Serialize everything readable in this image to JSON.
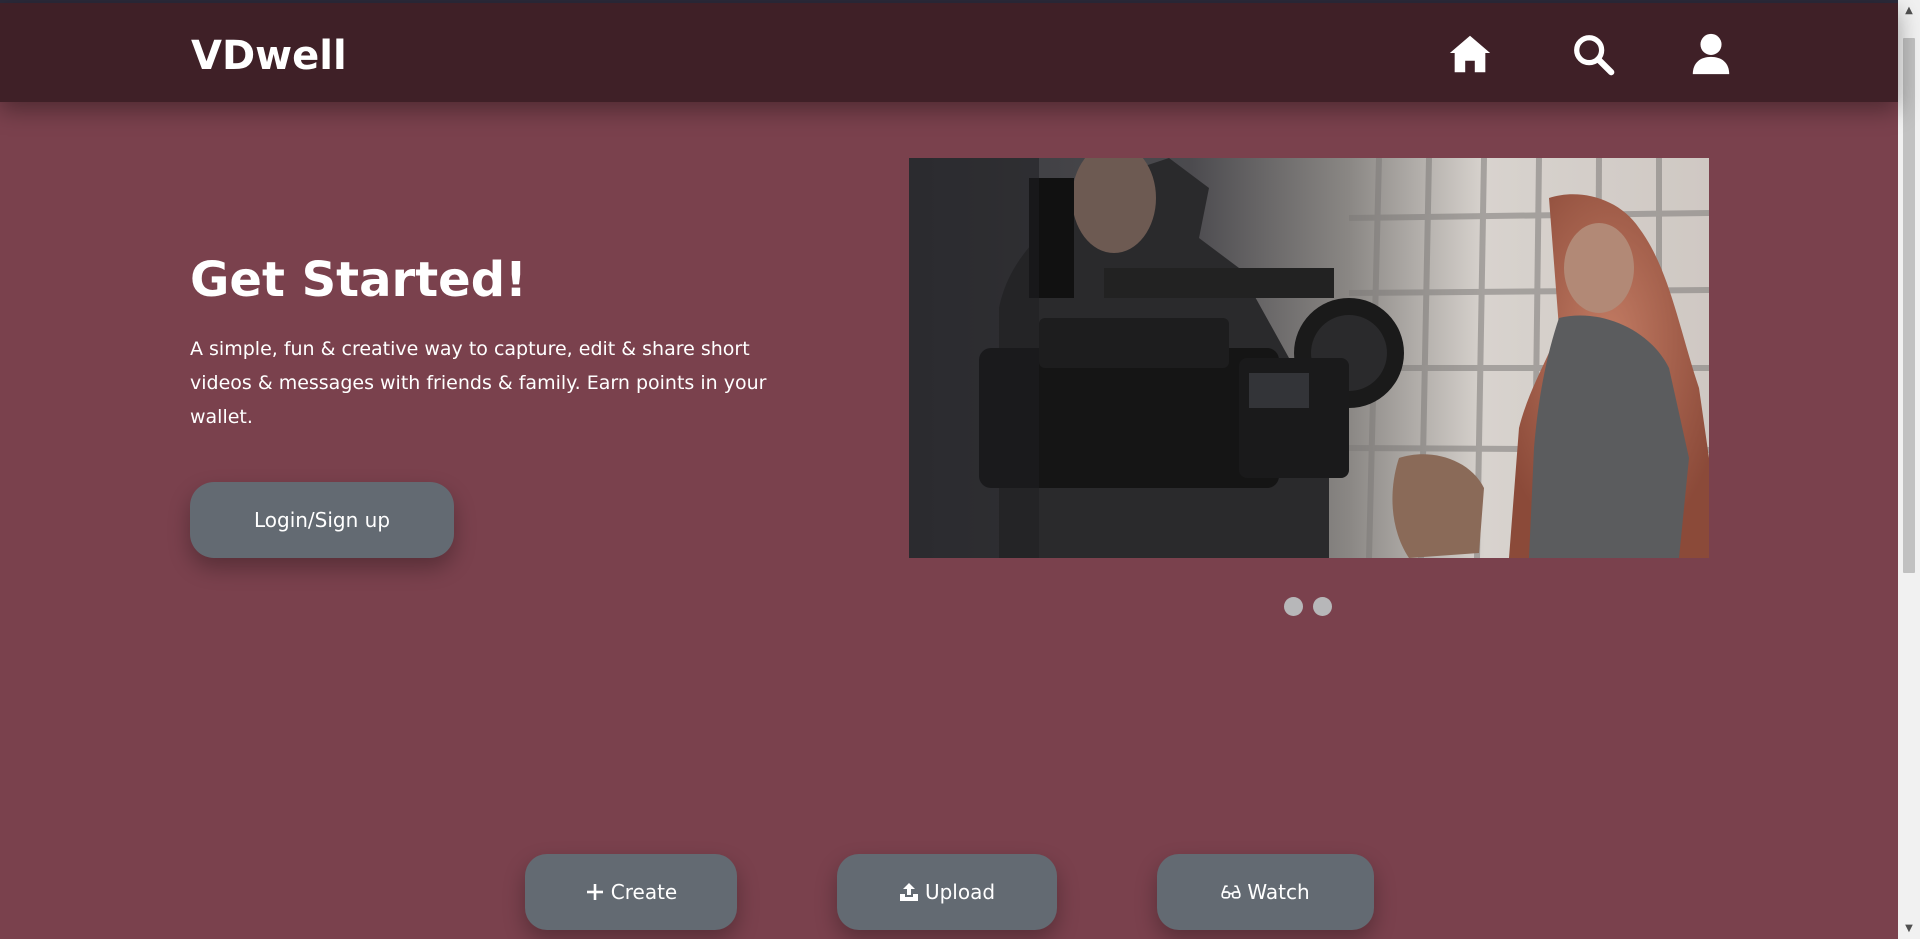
{
  "header": {
    "brand": "VDwell",
    "icons": [
      "home-icon",
      "search-icon",
      "user-icon"
    ]
  },
  "hero": {
    "title": "Get Started!",
    "description": "A simple, fun & creative way to capture, edit & share short videos & messages with friends & family. Earn points in your wallet.",
    "login_label": "Login/Sign up"
  },
  "carousel": {
    "slide_count": 2,
    "active_slide": 1
  },
  "actions": {
    "create_label": "Create",
    "upload_label": "Upload",
    "watch_label": "Watch"
  },
  "colors": {
    "background": "#7a414d",
    "navbar": "#3f2027",
    "button": "#636a72",
    "text": "#ffffff",
    "dot": "#b7b7b9"
  }
}
